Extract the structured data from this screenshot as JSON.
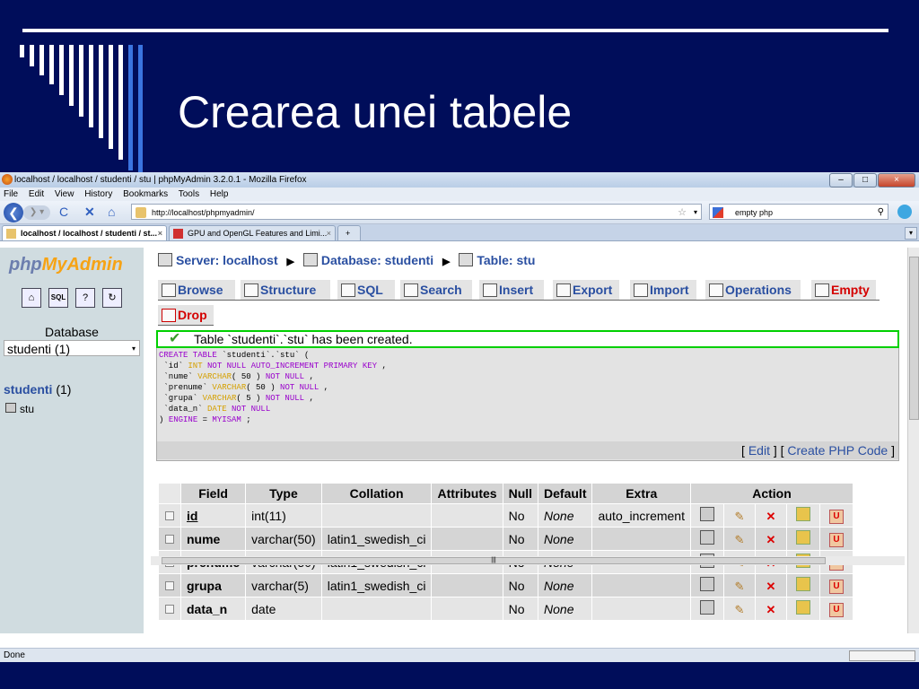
{
  "slide": {
    "title": "Crearea unei tabele"
  },
  "browser": {
    "window_title": "localhost / localhost / studenti / stu | phpMyAdmin 3.2.0.1 - Mozilla Firefox",
    "menu": [
      "File",
      "Edit",
      "View",
      "History",
      "Bookmarks",
      "Tools",
      "Help"
    ],
    "url": "http://localhost/phpmyadmin/",
    "search_value": "empty php",
    "tabs": [
      {
        "label": "localhost / localhost / studenti / st...",
        "active": true
      },
      {
        "label": "GPU and OpenGL Features and Limi...",
        "active": false
      }
    ],
    "new_tab": "+",
    "status": "Done"
  },
  "sidebar": {
    "logo_php": "php",
    "logo_rest": "MyAdmin",
    "buttons": [
      "home-icon",
      "sql-icon",
      "docs-icon",
      "reload-icon"
    ],
    "database_label": "Database",
    "database_select": "studenti (1)",
    "db_name": "studenti",
    "db_count": "(1)",
    "table": "stu"
  },
  "breadcrumb": {
    "server": "Server: localhost",
    "database": "Database: studenti",
    "table": "Table: stu"
  },
  "tabs": [
    "Browse",
    "Structure",
    "SQL",
    "Search",
    "Insert",
    "Export",
    "Import",
    "Operations",
    "Empty",
    "Drop"
  ],
  "message": "Table `studenti`.`stu` has been created.",
  "sql_links": {
    "open": "[",
    "edit": "Edit",
    "mid": "] [",
    "php": "Create PHP Code",
    "close": "]"
  },
  "structure": {
    "headers": [
      "Field",
      "Type",
      "Collation",
      "Attributes",
      "Null",
      "Default",
      "Extra",
      "Action"
    ],
    "rows": [
      {
        "field": "id",
        "type": "int(11)",
        "collation": "",
        "attributes": "",
        "null": "No",
        "default": "None",
        "extra": "auto_increment"
      },
      {
        "field": "nume",
        "type": "varchar(50)",
        "collation": "latin1_swedish_ci",
        "attributes": "",
        "null": "No",
        "default": "None",
        "extra": ""
      },
      {
        "field": "prenume",
        "type": "varchar(50)",
        "collation": "latin1_swedish_ci",
        "attributes": "",
        "null": "No",
        "default": "None",
        "extra": ""
      },
      {
        "field": "grupa",
        "type": "varchar(5)",
        "collation": "latin1_swedish_ci",
        "attributes": "",
        "null": "No",
        "default": "None",
        "extra": ""
      },
      {
        "field": "data_n",
        "type": "date",
        "collation": "",
        "attributes": "",
        "null": "No",
        "default": "None",
        "extra": ""
      }
    ]
  },
  "colors": {
    "slide_bg": "#000d5a",
    "link": "#2a4fa1",
    "success_border": "#00d000",
    "danger": "#d40000"
  }
}
